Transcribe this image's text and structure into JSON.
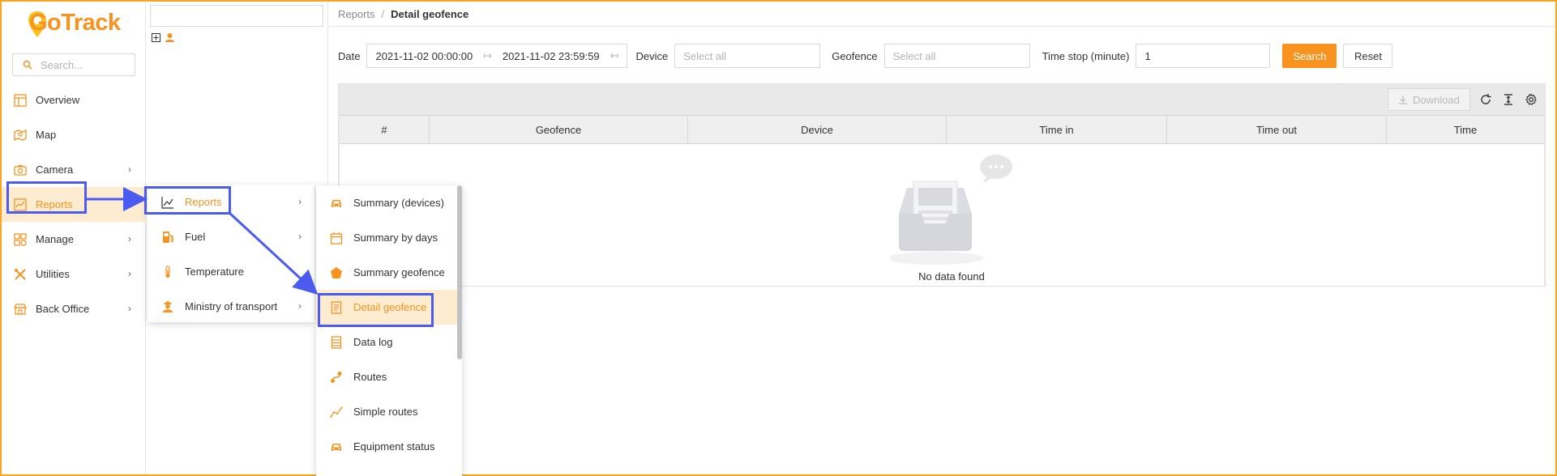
{
  "app": {
    "logo_text": "GoTrack"
  },
  "sidebar": {
    "search_placeholder": "Search...",
    "items": [
      {
        "label": "Overview",
        "icon": "overview-icon"
      },
      {
        "label": "Map",
        "icon": "map-icon"
      },
      {
        "label": "Camera",
        "icon": "camera-icon",
        "has_children": true
      },
      {
        "label": "Reports",
        "icon": "reports-icon",
        "has_children": true,
        "active": true
      },
      {
        "label": "Manage",
        "icon": "manage-icon",
        "has_children": true
      },
      {
        "label": "Utilities",
        "icon": "utilities-icon",
        "has_children": true
      },
      {
        "label": "Back Office",
        "icon": "back-office-icon",
        "has_children": true
      }
    ]
  },
  "submenu_reports": {
    "items": [
      {
        "label": "Reports",
        "icon": "chart-line-icon",
        "active": true
      },
      {
        "label": "Fuel",
        "icon": "fuel-icon"
      },
      {
        "label": "Temperature",
        "icon": "thermometer-icon"
      },
      {
        "label": "Ministry of transport",
        "icon": "officer-icon"
      }
    ]
  },
  "submenu_reports_list": {
    "items": [
      {
        "label": "Summary (devices)",
        "icon": "car-icon"
      },
      {
        "label": "Summary by days",
        "icon": "calendar-icon"
      },
      {
        "label": "Summary geofence",
        "icon": "pentagon-icon"
      },
      {
        "label": "Detail geofence",
        "icon": "document-icon",
        "active": true
      },
      {
        "label": "Data log",
        "icon": "list-icon"
      },
      {
        "label": "Routes",
        "icon": "route-icon"
      },
      {
        "label": "Simple routes",
        "icon": "line-chart-icon"
      },
      {
        "label": "Equipment status",
        "icon": "car-icon"
      }
    ]
  },
  "breadcrumb": {
    "parent": "Reports",
    "separator": "/",
    "current": "Detail geofence"
  },
  "filters": {
    "date_label": "Date",
    "date_start": "2021-11-02 00:00:00",
    "date_end": "2021-11-02 23:59:59",
    "device_label": "Device",
    "device_placeholder": "Select all",
    "geofence_label": "Geofence",
    "geofence_placeholder": "Select all",
    "time_stop_label": "Time stop (minute)",
    "time_stop_value": "1",
    "search_label": "Search",
    "reset_label": "Reset"
  },
  "table": {
    "download_label": "Download",
    "columns": [
      "#",
      "Geofence",
      "Device",
      "Time in",
      "Time out",
      "Time"
    ],
    "empty_text": "No data found"
  },
  "colors": {
    "accent": "#f7931e",
    "highlight": "#4b5bf0",
    "active_bg": "#fdecd0"
  }
}
